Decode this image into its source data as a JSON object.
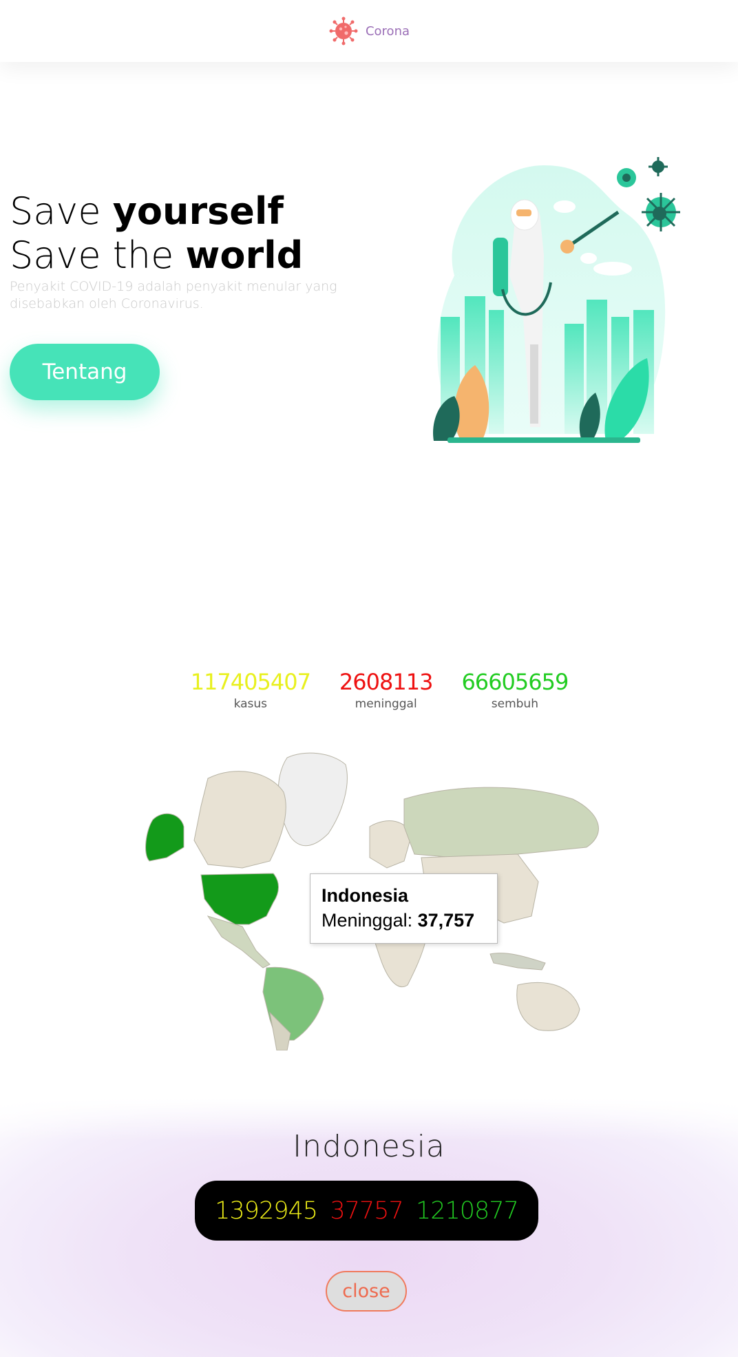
{
  "nav": {
    "brand": "Corona",
    "icon": "virus-icon"
  },
  "hero": {
    "line1_light": "Save ",
    "line1_bold": "yourself",
    "line2_light": "Save the ",
    "line2_bold": "world",
    "description": "Penyakit COVID-19 adalah penyakit menular yang disebabkan oleh Coronavirus.",
    "button_label": "Tentang",
    "illustration": "health-worker-spraying-virus-illustration"
  },
  "stats": [
    {
      "value": "117405407",
      "label": "kasus",
      "color": "#e8f01e"
    },
    {
      "value": "2608113",
      "label": "meninggal",
      "color": "#ee1111"
    },
    {
      "value": "66605659",
      "label": "sembuh",
      "color": "#22cc22"
    }
  ],
  "map": {
    "tooltip_country": "Indonesia",
    "tooltip_label": "Meninggal:",
    "tooltip_value": "37,757"
  },
  "detail": {
    "country": "Indonesia",
    "cases": "1392945",
    "deaths": "37757",
    "recovered": "1210877",
    "close_label": "close"
  },
  "colors": {
    "accent": "#46e3b8",
    "brand_text": "#9b6fb7",
    "cases": "#f2f218",
    "deaths": "#ee1111",
    "recovered": "#22cc22"
  }
}
